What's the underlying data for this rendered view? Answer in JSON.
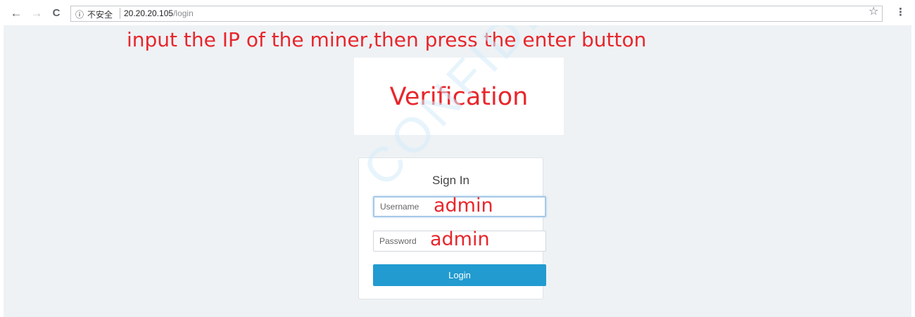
{
  "browser": {
    "back_icon": "←",
    "forward_icon": "→",
    "reload_icon": "C",
    "info_icon": "ⓘ",
    "security_text": "不安全",
    "url_host": "20.20.20.105",
    "url_path": "/login",
    "star_icon": "☆",
    "menu_icon": "⋮"
  },
  "annotation": {
    "instruction": "input the IP of the miner,then press the enter button",
    "verification": "Verification",
    "watermark": "CONFIDENTIAL",
    "color": "#e8262b"
  },
  "login": {
    "title": "Sign In",
    "username_placeholder": "Username",
    "username_value": "admin",
    "password_placeholder": "Password",
    "password_value": "admin",
    "button_label": "Login"
  },
  "colors": {
    "page_background": "#eef2f5",
    "button": "#229bd0"
  }
}
